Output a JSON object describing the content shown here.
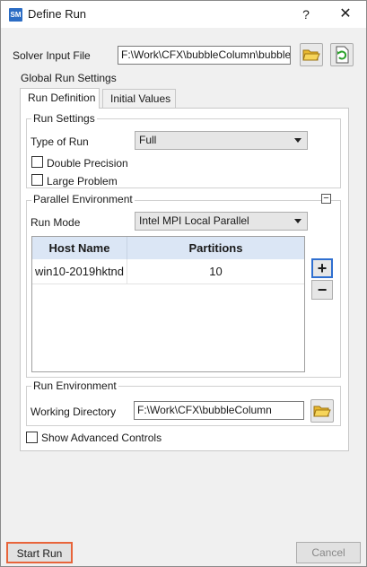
{
  "window": {
    "app_icon_text": "SM",
    "title": "Define Run",
    "help_glyph": "?",
    "close_glyph": "✕"
  },
  "solver_input": {
    "label": "Solver Input File",
    "value": "F:\\Work\\CFX\\bubbleColumn\\bubble.def"
  },
  "global_settings": {
    "title": "Global Run Settings",
    "tabs": [
      {
        "label": "Run Definition",
        "active": true
      },
      {
        "label": "Initial Values",
        "active": false
      }
    ]
  },
  "run_settings": {
    "title": "Run Settings",
    "type_label": "Type of Run",
    "type_value": "Full",
    "double_precision_label": "Double Precision",
    "double_precision_checked": false,
    "large_problem_label": "Large Problem",
    "large_problem_checked": false
  },
  "parallel": {
    "title": "Parallel Environment",
    "collapse_glyph": "−",
    "run_mode_label": "Run Mode",
    "run_mode_value": "Intel MPI Local Parallel",
    "columns": [
      "Host Name",
      "Partitions"
    ],
    "rows": [
      {
        "host": "win10-2019hktnd",
        "partitions": "10"
      }
    ],
    "add_glyph": "+",
    "remove_glyph": "−"
  },
  "run_env": {
    "title": "Run Environment",
    "working_dir_label": "Working Directory",
    "working_dir_value": "F:\\Work\\CFX\\bubbleColumn"
  },
  "advanced": {
    "label": "Show Advanced Controls",
    "checked": false
  },
  "footer": {
    "start_run_label": "Start Run",
    "right_button_label": "Cancel"
  },
  "colors": {
    "highlight": "#e8643a",
    "app_icon": "#2b6cc4",
    "table_header": "#dbe6f5",
    "add_button_border": "#2f6fd0"
  }
}
